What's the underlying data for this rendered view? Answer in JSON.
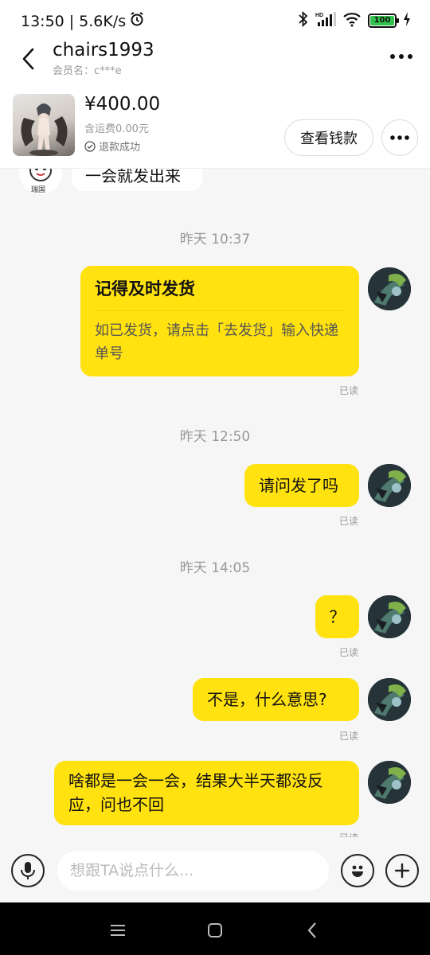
{
  "status_bar": {
    "time": "13:50",
    "network_speed": "5.6K/s",
    "battery": "100",
    "icons": [
      "alarm-icon",
      "bluetooth-icon",
      "hd-signal-icon",
      "wifi-icon",
      "battery-icon",
      "charging-icon"
    ]
  },
  "header": {
    "title": "chairs1993",
    "subtitle": "会员名：c***e",
    "icons": [
      "back-icon",
      "more-icon"
    ]
  },
  "order": {
    "price": "¥400.00",
    "shipping": "含运费0.00元",
    "refund_status": "退款成功",
    "view_button": "查看钱款",
    "icons": [
      "check-circle-icon",
      "more-icon"
    ]
  },
  "messages": {
    "partial_text": "一会就发出来",
    "seller_avatar_caption": "瑞国",
    "t1": "昨天 10:37",
    "card_title": "记得及时发货",
    "card_body": "如已发货，请点击「去发货」输入快递单号",
    "read1": "已读",
    "t2": "昨天 12:50",
    "m2": "请问发了吗",
    "read2": "已读",
    "t3": "昨天 14:05",
    "m3": "？",
    "read3": "已读",
    "m4": "不是，什么意思?",
    "read4": "已读",
    "m5": "啥都是一会一会，结果大半天都没反应，问也不回",
    "read5": "已读"
  },
  "input_bar": {
    "placeholder": "想跟TA说点什么...",
    "icons": [
      "microphone-icon",
      "emoji-icon",
      "plus-icon"
    ]
  },
  "nav_bar": {
    "icons": [
      "menu-icon",
      "home-icon",
      "back-icon"
    ]
  },
  "colors": {
    "bubble": "#ffe20f",
    "background": "#f6f6f6",
    "battery": "#32c24d"
  }
}
